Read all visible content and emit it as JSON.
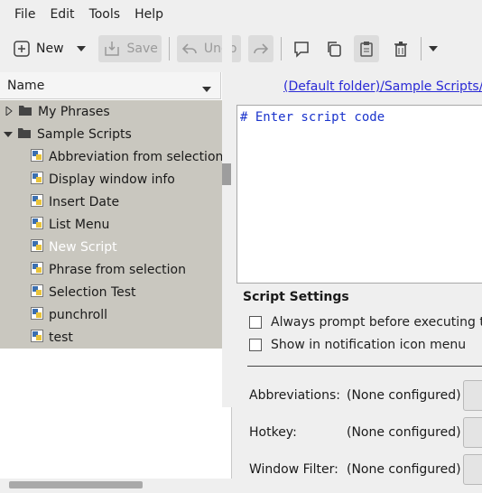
{
  "menubar": {
    "items": [
      "File",
      "Edit",
      "Tools",
      "Help"
    ]
  },
  "toolbar": {
    "new_label": "New",
    "save_label": "Save",
    "undo_label": "Undo"
  },
  "tree": {
    "header": "Name",
    "items": [
      {
        "label": "My Phrases",
        "type": "folder",
        "expanded": false
      },
      {
        "label": "Sample Scripts",
        "type": "folder",
        "expanded": true
      },
      {
        "label": "Abbreviation from selection",
        "type": "script"
      },
      {
        "label": "Display window info",
        "type": "script"
      },
      {
        "label": "Insert Date",
        "type": "script"
      },
      {
        "label": "List Menu",
        "type": "script"
      },
      {
        "label": "New Script",
        "type": "script",
        "selected": true
      },
      {
        "label": "Phrase from selection",
        "type": "script"
      },
      {
        "label": "Selection Test",
        "type": "script"
      },
      {
        "label": "punchroll",
        "type": "script"
      },
      {
        "label": "test",
        "type": "script"
      }
    ]
  },
  "editor": {
    "path_link": "(Default folder)/Sample Scripts/",
    "code": "# Enter script code"
  },
  "settings": {
    "title": "Script Settings",
    "always_prompt": "Always prompt before executing th",
    "show_notification": "Show in notification icon menu",
    "abbreviations_label": "Abbreviations:",
    "abbreviations_value": "(None configured)",
    "hotkey_label": "Hotkey:",
    "hotkey_value": "(None configured)",
    "window_filter_label": "Window Filter:",
    "window_filter_value": "(None configured)"
  },
  "colors": {
    "tree_bg": "#c9c7bf",
    "link": "#2a2ad6",
    "code": "#1a33cc"
  }
}
